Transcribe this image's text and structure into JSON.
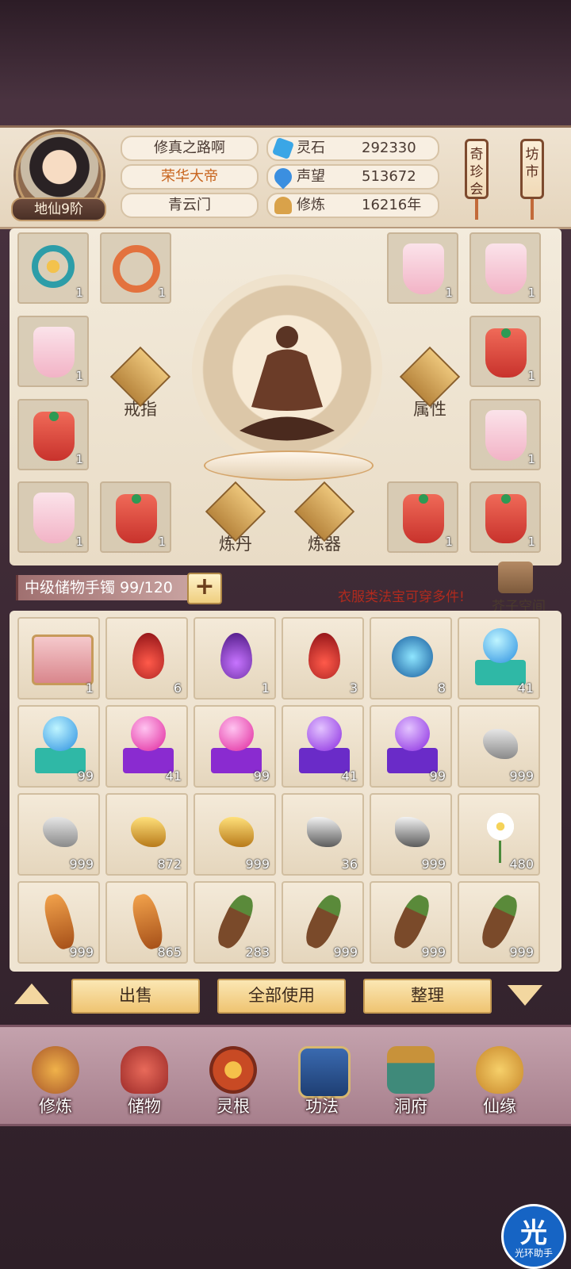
{
  "header": {
    "rank": "地仙9阶",
    "name": "修真之路啊",
    "title": "荣华大帝",
    "sect": "青云门",
    "resources": [
      {
        "label": "灵石",
        "value": "292330",
        "icon": "spirit-stone-icon",
        "color": "#3aa6e6"
      },
      {
        "label": "声望",
        "value": "513672",
        "icon": "reputation-icon",
        "color": "#3b8fe0"
      },
      {
        "label": "修炼",
        "value": "16216年",
        "icon": "meditation-icon",
        "color": "#d9a24a"
      }
    ],
    "qizhenhui": "奇珍会",
    "fangshi": "坊市"
  },
  "equipment": {
    "left": [
      "1",
      "1",
      "1",
      "1",
      "1",
      "1"
    ],
    "right": [
      "1",
      "1",
      "1",
      "1",
      "1",
      "1"
    ],
    "ring_label": "戒指",
    "attr_label": "属性",
    "alchemy_label": "炼丹",
    "forge_label": "炼器"
  },
  "storage": {
    "name_capacity": "中级储物手镯 99/120",
    "plus": "+",
    "notice": "衣服类法宝可穿多件!",
    "jiezi_label": "芥子空间"
  },
  "inventory": {
    "items": [
      {
        "icon": "treasure-box-icon",
        "count": "1"
      },
      {
        "icon": "red-flame-icon",
        "count": "6"
      },
      {
        "icon": "purple-flame-icon",
        "count": "1"
      },
      {
        "icon": "red-flame-icon",
        "count": "3"
      },
      {
        "icon": "blue-spirit-orb-icon",
        "count": "8"
      },
      {
        "icon": "blue-pearl-stand-icon",
        "count": "41"
      },
      {
        "icon": "blue-pearl-stand-icon",
        "count": "99"
      },
      {
        "icon": "magenta-pearl-stand-icon",
        "count": "41"
      },
      {
        "icon": "magenta-pearl-stand-icon",
        "count": "99"
      },
      {
        "icon": "purple-pearl-stand-icon",
        "count": "41"
      },
      {
        "icon": "purple-pearl-stand-icon",
        "count": "99"
      },
      {
        "icon": "gray-ore-icon",
        "count": "999"
      },
      {
        "icon": "gray-ore-icon",
        "count": "999"
      },
      {
        "icon": "gold-ore-icon",
        "count": "872"
      },
      {
        "icon": "gold-ore-icon",
        "count": "999"
      },
      {
        "icon": "iron-ore-icon",
        "count": "36"
      },
      {
        "icon": "iron-ore-icon",
        "count": "999"
      },
      {
        "icon": "white-flower-icon",
        "count": "480"
      },
      {
        "icon": "ginseng-icon",
        "count": "999"
      },
      {
        "icon": "ginseng-icon",
        "count": "865"
      },
      {
        "icon": "herb-root-icon",
        "count": "283"
      },
      {
        "icon": "herb-root-icon",
        "count": "999"
      },
      {
        "icon": "herb-root-icon",
        "count": "999"
      },
      {
        "icon": "herb-root-icon",
        "count": "999"
      }
    ]
  },
  "actions": {
    "sell": "出售",
    "use_all": "全部使用",
    "sort": "整理"
  },
  "nav": [
    {
      "label": "修炼",
      "icon": "cultivation-icon"
    },
    {
      "label": "储物",
      "icon": "storage-bag-icon"
    },
    {
      "label": "灵根",
      "icon": "spirit-root-icon"
    },
    {
      "label": "功法",
      "icon": "technique-book-icon"
    },
    {
      "label": "洞府",
      "icon": "cave-house-icon"
    },
    {
      "label": "仙缘",
      "icon": "fate-gourd-icon"
    }
  ],
  "helper": {
    "glyph": "光",
    "label": "光环助手"
  },
  "colors": {
    "accent_gold": "#efc472",
    "title_orange": "#c8651f",
    "notice_red": "#b02a1e"
  }
}
